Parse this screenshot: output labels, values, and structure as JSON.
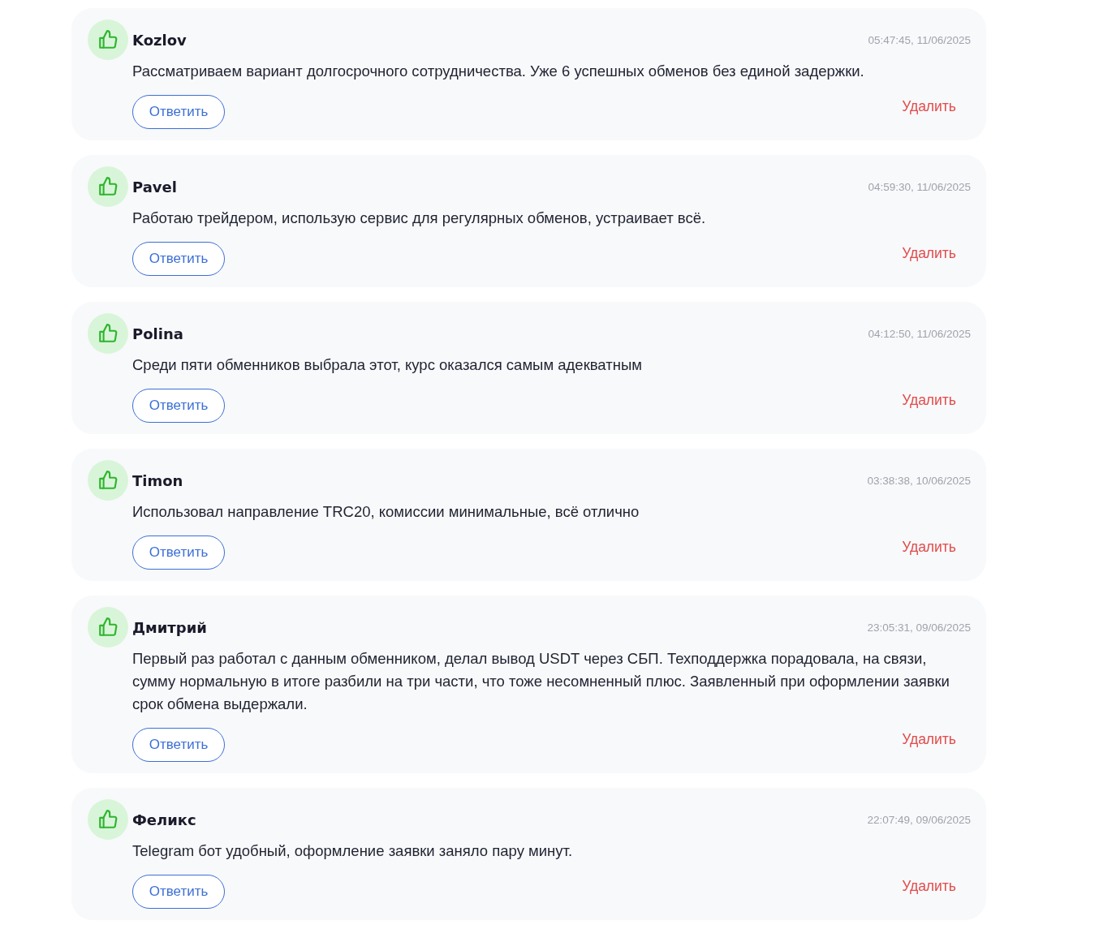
{
  "reviews": [
    {
      "author": "Kozlov",
      "time": "05:47:45, 11/06/2025",
      "text": "Рассматриваем вариант долгосрочного сотрудничества. Уже 6 успешных обменов без единой задержки.",
      "reply": "Ответить",
      "delete": "Удалить"
    },
    {
      "author": "Pavel",
      "time": "04:59:30, 11/06/2025",
      "text": "Работаю трейдером, использую сервис для регулярных обменов, устраивает всё.",
      "reply": "Ответить",
      "delete": "Удалить"
    },
    {
      "author": "Polina",
      "time": "04:12:50, 11/06/2025",
      "text": "Среди пяти обменников выбрала этот, курс оказался самым адекватным",
      "reply": "Ответить",
      "delete": "Удалить"
    },
    {
      "author": "Timon",
      "time": "03:38:38, 10/06/2025",
      "text": "Использовал направление TRC20, комиссии минимальные, всё отлично",
      "reply": "Ответить",
      "delete": "Удалить"
    },
    {
      "author": "Дмитрий",
      "time": "23:05:31, 09/06/2025",
      "text": "Первый раз работал с данным обменником, делал вывод USDT через СБП. Техподдержка порадовала, на связи, сумму нормальную в итоге разбили на три части, что тоже несомненный плюс. Заявленный при оформлении заявки срок обмена выдержали.",
      "reply": "Ответить",
      "delete": "Удалить"
    },
    {
      "author": "Феликс",
      "time": "22:07:49, 09/06/2025",
      "text": "Telegram бот удобный, оформление заявки заняло пару минут.",
      "reply": "Ответить",
      "delete": "Удалить"
    }
  ]
}
